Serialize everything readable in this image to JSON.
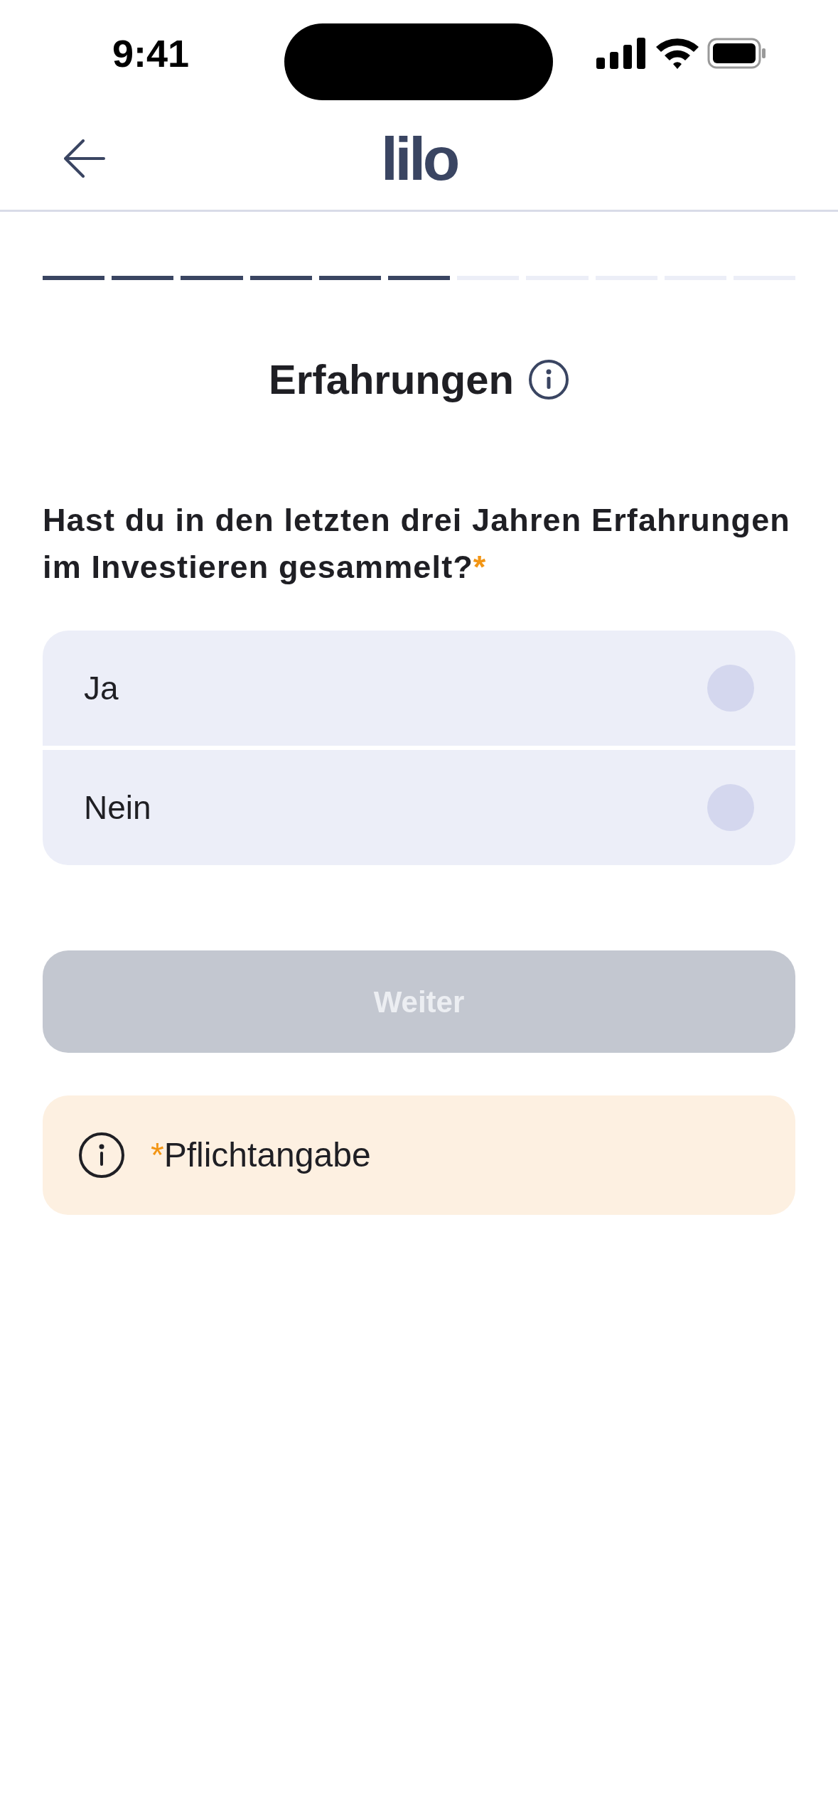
{
  "status_bar": {
    "time": "9:41"
  },
  "header": {
    "logo": "lilo"
  },
  "progress": [
    {
      "done": true
    },
    {
      "done": true
    },
    {
      "done": true
    },
    {
      "done": true
    },
    {
      "done": true
    },
    {
      "done": true
    },
    {
      "done": false
    },
    {
      "done": false
    },
    {
      "done": false
    },
    {
      "done": false
    },
    {
      "done": false
    }
  ],
  "title": "Erfahrungen",
  "question": {
    "text": "Hast du in den letzten drei Jahren Erfahrungen im Investieren gesammelt?",
    "required_mark": "*"
  },
  "options": [
    {
      "label": "Ja",
      "selected": false
    },
    {
      "label": "Nein",
      "selected": false
    }
  ],
  "button": {
    "label": "Weiter",
    "disabled": true
  },
  "note": {
    "mark": "*",
    "text": "Pflichtangabe"
  }
}
